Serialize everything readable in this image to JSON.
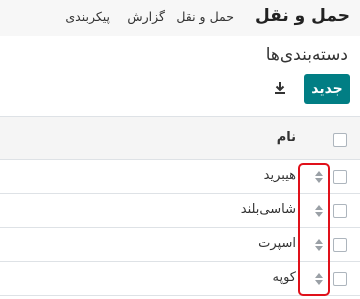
{
  "navbar": {
    "brand": "حمل و نقل",
    "menu": [
      "حمل و نقل",
      "گزارش",
      "پیکربندی"
    ]
  },
  "page": {
    "title": "دسته‌بندی‌ها",
    "new_button": "جدید"
  },
  "table": {
    "columns": [
      "نام"
    ],
    "rows": [
      {
        "name": "هیبرید"
      },
      {
        "name": "شاسی‌بلند"
      },
      {
        "name": "اسپرت"
      },
      {
        "name": "کوپه"
      }
    ]
  },
  "colors": {
    "primary": "#017e84",
    "highlight": "#e0101a"
  }
}
